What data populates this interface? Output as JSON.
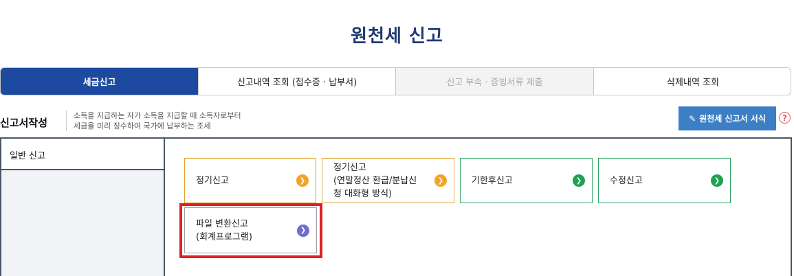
{
  "page_title": "원천세 신고",
  "tabs": [
    {
      "label": "세금신고",
      "state": "active"
    },
    {
      "label": "신고내역 조회 (접수증 · 납부서)",
      "state": "normal"
    },
    {
      "label": "신고 부속 · 증빙서류 제출",
      "state": "disabled"
    },
    {
      "label": "삭제내역 조회",
      "state": "normal"
    }
  ],
  "section": {
    "title": "신고서작성",
    "desc_line1": "소득을 지급하는 자가 소득을 지급할 때 소득자로부터",
    "desc_line2": "세금을 미리 징수하여 국가에 납부하는 조세",
    "form_button": "원천세 신고서 서식",
    "help": "?"
  },
  "left_menu": {
    "item": "일반 신고"
  },
  "cards": [
    {
      "label": "정기신고",
      "color": "#e0a12e",
      "icon": "chevron-right-icon"
    },
    {
      "label": "정기신고\n(연말정산 환급/분납신\n청 대화형 방식)",
      "color": "#e0a12e",
      "icon": "chevron-right-icon"
    },
    {
      "label": "기한후신고",
      "color": "#2ea564",
      "icon": "chevron-right-icon"
    },
    {
      "label": "수정신고",
      "color": "#2ea564",
      "icon": "chevron-right-icon"
    },
    {
      "label": "파일 변환신고\n(회계프로그램)",
      "color": "#6b6fd1",
      "icon": "chevron-right-icon"
    }
  ],
  "colors": {
    "primary": "#1d4aa0",
    "highlight": "#e02020"
  }
}
